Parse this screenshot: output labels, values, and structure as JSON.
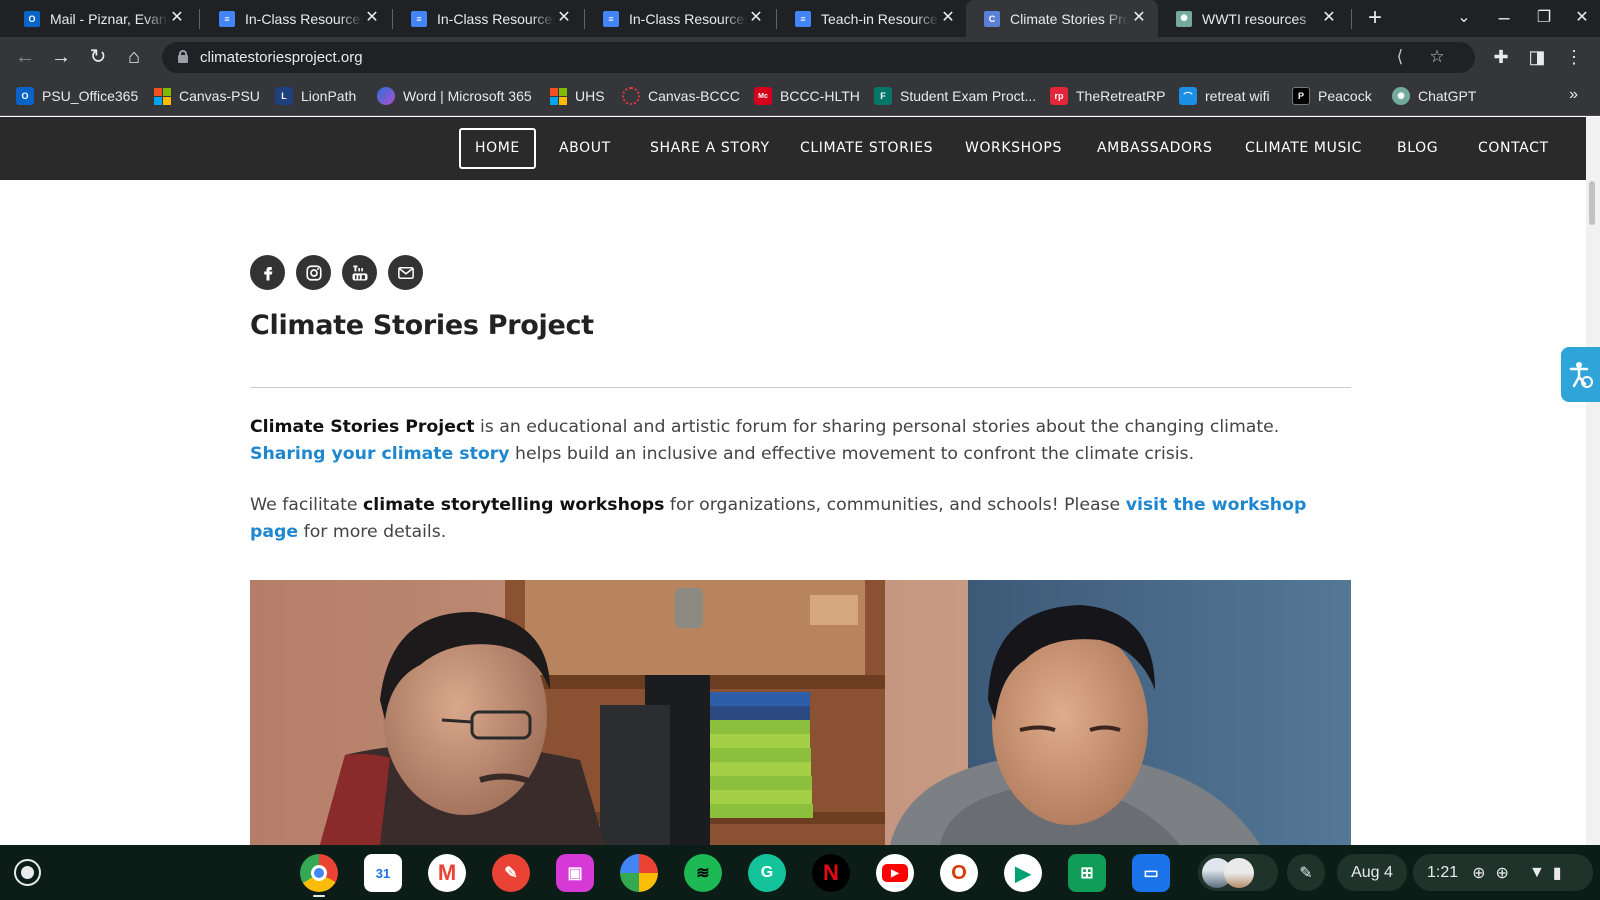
{
  "browser": {
    "tabs": [
      {
        "title": "Mail - Piznar, Evan R",
        "favicon": "outlook-icon"
      },
      {
        "title": "In-Class Resources",
        "favicon": "google-docs-icon"
      },
      {
        "title": "In-Class Resources",
        "favicon": "google-docs-icon"
      },
      {
        "title": "In-Class Resources",
        "favicon": "google-docs-icon"
      },
      {
        "title": "Teach-in Resources",
        "favicon": "google-docs-icon"
      },
      {
        "title": "Climate Stories Project",
        "favicon": "climate-stories-icon",
        "active": true
      },
      {
        "title": "WWTI resources",
        "favicon": "chatgpt-icon"
      }
    ],
    "url": "climatestoriesproject.org",
    "bookmarks": [
      {
        "label": "PSU_Office365",
        "icon": "outlook-icon"
      },
      {
        "label": "Canvas-PSU",
        "icon": "microsoft-grid-icon"
      },
      {
        "label": "LionPath",
        "icon": "lionpath-icon"
      },
      {
        "label": "Word | Microsoft 365",
        "icon": "microsoft365-icon"
      },
      {
        "label": "UHS",
        "icon": "microsoft-grid-icon"
      },
      {
        "label": "Canvas-BCCC",
        "icon": "canvas-icon"
      },
      {
        "label": "BCCC-HLTH",
        "icon": "mcgraw-hill-icon"
      },
      {
        "label": "Student Exam Proct...",
        "icon": "forms-icon"
      },
      {
        "label": "TheRetreatRP",
        "icon": "retreat-icon"
      },
      {
        "label": "retreat wifi",
        "icon": "wifi-bookmark-icon"
      },
      {
        "label": "Peacock",
        "icon": "peacock-icon"
      },
      {
        "label": "ChatGPT",
        "icon": "chatgpt-icon"
      }
    ]
  },
  "site": {
    "nav": [
      "HOME",
      "ABOUT",
      "SHARE A STORY",
      "CLIMATE STORIES",
      "WORKSHOPS",
      "AMBASSADORS",
      "CLIMATE MUSIC",
      "BLOG",
      "CONTACT"
    ],
    "social": [
      "facebook-icon",
      "instagram-icon",
      "youtube-icon",
      "email-icon"
    ],
    "title": "Climate Stories Project",
    "intro": {
      "lead": "Climate Stories Project",
      "text1": " is an educational and artistic forum for sharing personal stories about the changing climate. ",
      "link": "Sharing your climate story",
      "text2": " helps build an inclusive and effective movement to confront the climate crisis."
    },
    "workshops": {
      "text1": "We facilitate ",
      "bold": "climate storytelling workshops",
      "text2": " for organizations, communities, and schools! Please ",
      "link": "visit the workshop page",
      "text3": " for more details."
    },
    "colors": {
      "nav_bg": "#2a2a2a",
      "link": "#1e87d0",
      "accessibility": "#2fa4d8"
    }
  },
  "shelf": {
    "apps": [
      "chrome-icon",
      "calendar-icon",
      "gmail-icon",
      "paint-icon",
      "screencast-icon",
      "photos-icon",
      "spotify-icon",
      "grammarly-icon",
      "netflix-icon",
      "youtube-icon",
      "office-icon",
      "play-store-icon",
      "sheets-icon",
      "files-icon"
    ],
    "calendar_day": "31",
    "date": "Aug 4",
    "time": "1:21"
  }
}
